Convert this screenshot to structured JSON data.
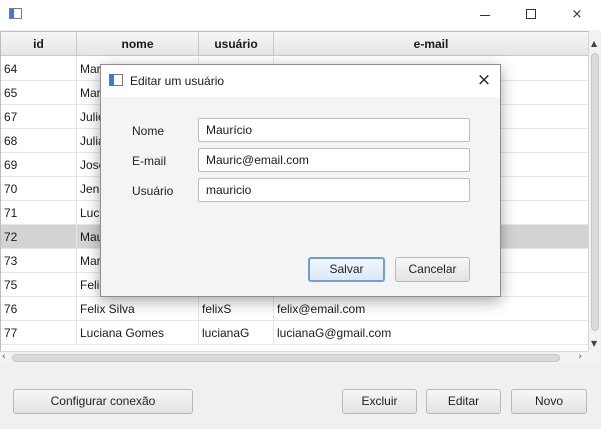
{
  "window": {
    "title": "",
    "controls": {
      "minimize": "minimize",
      "maximize": "maximize",
      "close": "×"
    }
  },
  "table": {
    "columns": [
      "id",
      "nome",
      "usuário",
      "e-mail"
    ],
    "rows": [
      {
        "id": "64",
        "nome": "Mari",
        "usuario": "",
        "email": "",
        "selected": false
      },
      {
        "id": "65",
        "nome": "Mar",
        "usuario": "",
        "email": "",
        "selected": false
      },
      {
        "id": "67",
        "nome": "Julio",
        "usuario": "",
        "email": "",
        "selected": false
      },
      {
        "id": "68",
        "nome": "Julia",
        "usuario": "",
        "email": "",
        "selected": false
      },
      {
        "id": "69",
        "nome": "Jose",
        "usuario": "",
        "email": "",
        "selected": false
      },
      {
        "id": "70",
        "nome": "Jeni",
        "usuario": "",
        "email": "",
        "selected": false
      },
      {
        "id": "71",
        "nome": "Luci",
        "usuario": "",
        "email": "",
        "selected": false
      },
      {
        "id": "72",
        "nome": "Mau",
        "usuario": "",
        "email": "",
        "selected": true
      },
      {
        "id": "73",
        "nome": "Mar",
        "usuario": "",
        "email": "",
        "selected": false
      },
      {
        "id": "75",
        "nome": "Felic",
        "usuario": "",
        "email": "",
        "selected": false
      },
      {
        "id": "76",
        "nome": "Felix Silva",
        "usuario": "felixS",
        "email": "felix@email.com",
        "selected": false
      },
      {
        "id": "77",
        "nome": "Luciana Gomes",
        "usuario": "lucianaG",
        "email": "lucianaG@gmail.com",
        "selected": false
      }
    ]
  },
  "buttons": {
    "configurar": "Configurar conexão",
    "excluir": "Excluir",
    "editar": "Editar",
    "novo": "Novo"
  },
  "dialog": {
    "title": "Editar um usuário",
    "close": "×",
    "fields": {
      "nome_label": "Nome",
      "nome_value": "Maurício",
      "email_label": "E-mail",
      "email_value": "Mauric@email.com",
      "usuario_label": "Usuário",
      "usuario_value": "mauricio"
    },
    "salvar": "Salvar",
    "cancelar": "Cancelar"
  }
}
